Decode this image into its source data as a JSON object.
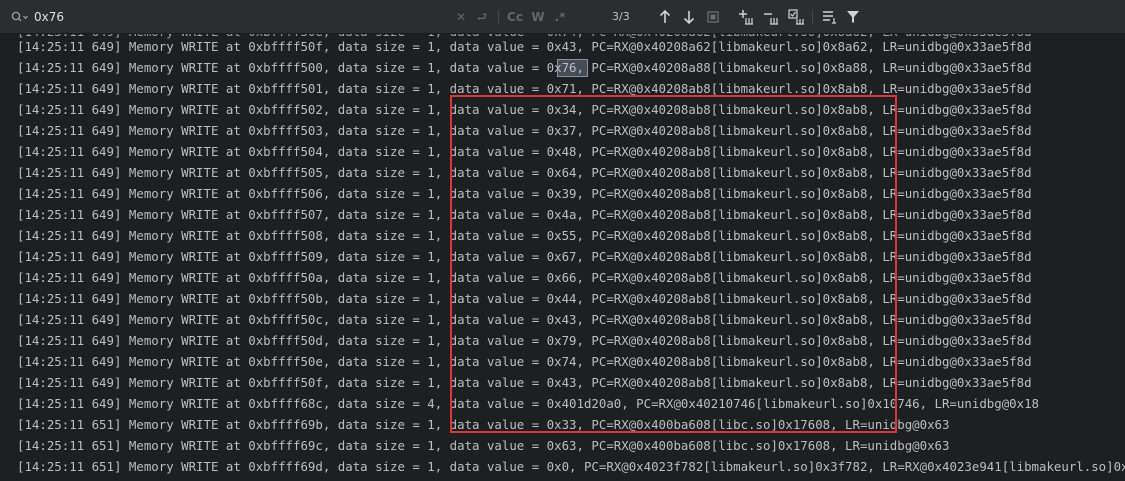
{
  "find_bar": {
    "search_value": "0x76",
    "match_case_label": "Cc",
    "words_label": "W",
    "regex_label": ".*",
    "match_count": "3/3"
  },
  "log_lines": [
    "[14:25:11 649] Memory WRITE at 0xbffff50f, data size = 1, data value = 0x43, PC=RX@0x40208a62[libmakeurl.so]0x8a62, LR=unidbg@0x33ae5f8d",
    "[14:25:11 649] Memory WRITE at 0xbffff500, data size = 1, data value = 0x76, PC=RX@0x40208a88[libmakeurl.so]0x8a88, LR=unidbg@0x33ae5f8d",
    "[14:25:11 649] Memory WRITE at 0xbffff501, data size = 1, data value = 0x71, PC=RX@0x40208ab8[libmakeurl.so]0x8ab8, LR=unidbg@0x33ae5f8d",
    "[14:25:11 649] Memory WRITE at 0xbffff502, data size = 1, data value = 0x34, PC=RX@0x40208ab8[libmakeurl.so]0x8ab8, LR=unidbg@0x33ae5f8d",
    "[14:25:11 649] Memory WRITE at 0xbffff503, data size = 1, data value = 0x37, PC=RX@0x40208ab8[libmakeurl.so]0x8ab8, LR=unidbg@0x33ae5f8d",
    "[14:25:11 649] Memory WRITE at 0xbffff504, data size = 1, data value = 0x48, PC=RX@0x40208ab8[libmakeurl.so]0x8ab8, LR=unidbg@0x33ae5f8d",
    "[14:25:11 649] Memory WRITE at 0xbffff505, data size = 1, data value = 0x64, PC=RX@0x40208ab8[libmakeurl.so]0x8ab8, LR=unidbg@0x33ae5f8d",
    "[14:25:11 649] Memory WRITE at 0xbffff506, data size = 1, data value = 0x39, PC=RX@0x40208ab8[libmakeurl.so]0x8ab8, LR=unidbg@0x33ae5f8d",
    "[14:25:11 649] Memory WRITE at 0xbffff507, data size = 1, data value = 0x4a, PC=RX@0x40208ab8[libmakeurl.so]0x8ab8, LR=unidbg@0x33ae5f8d",
    "[14:25:11 649] Memory WRITE at 0xbffff508, data size = 1, data value = 0x55, PC=RX@0x40208ab8[libmakeurl.so]0x8ab8, LR=unidbg@0x33ae5f8d",
    "[14:25:11 649] Memory WRITE at 0xbffff509, data size = 1, data value = 0x67, PC=RX@0x40208ab8[libmakeurl.so]0x8ab8, LR=unidbg@0x33ae5f8d",
    "[14:25:11 649] Memory WRITE at 0xbffff50a, data size = 1, data value = 0x66, PC=RX@0x40208ab8[libmakeurl.so]0x8ab8, LR=unidbg@0x33ae5f8d",
    "[14:25:11 649] Memory WRITE at 0xbffff50b, data size = 1, data value = 0x44, PC=RX@0x40208ab8[libmakeurl.so]0x8ab8, LR=unidbg@0x33ae5f8d",
    "[14:25:11 649] Memory WRITE at 0xbffff50c, data size = 1, data value = 0x43, PC=RX@0x40208ab8[libmakeurl.so]0x8ab8, LR=unidbg@0x33ae5f8d",
    "[14:25:11 649] Memory WRITE at 0xbffff50d, data size = 1, data value = 0x79, PC=RX@0x40208ab8[libmakeurl.so]0x8ab8, LR=unidbg@0x33ae5f8d",
    "[14:25:11 649] Memory WRITE at 0xbffff50e, data size = 1, data value = 0x74, PC=RX@0x40208ab8[libmakeurl.so]0x8ab8, LR=unidbg@0x33ae5f8d",
    "[14:25:11 649] Memory WRITE at 0xbffff50f, data size = 1, data value = 0x43, PC=RX@0x40208ab8[libmakeurl.so]0x8ab8, LR=unidbg@0x33ae5f8d",
    "[14:25:11 649] Memory WRITE at 0xbffff68c, data size = 4, data value = 0x401d20a0, PC=RX@0x40210746[libmakeurl.so]0x10746, LR=unidbg@0x18",
    "[14:25:11 651] Memory WRITE at 0xbffff69b, data size = 1, data value = 0x33, PC=RX@0x400ba608[libc.so]0x17608, LR=unidbg@0x63",
    "[14:25:11 651] Memory WRITE at 0xbffff69c, data size = 1, data value = 0x63, PC=RX@0x400ba608[libc.so]0x17608, LR=unidbg@0x63",
    "[14:25:11 651] Memory WRITE at 0xbffff69d, data size = 1, data value = 0x0, PC=RX@0x4023f782[libmakeurl.so]0x3f782, LR=RX@0x4023e941[libmakeurl.so]0x3e941"
  ],
  "colors": {
    "background": "#1e1f22",
    "toolbar": "#2b2d30",
    "text": "#bcbec4",
    "annotation_box": "#d9383a",
    "match_highlight": "#464b58"
  }
}
